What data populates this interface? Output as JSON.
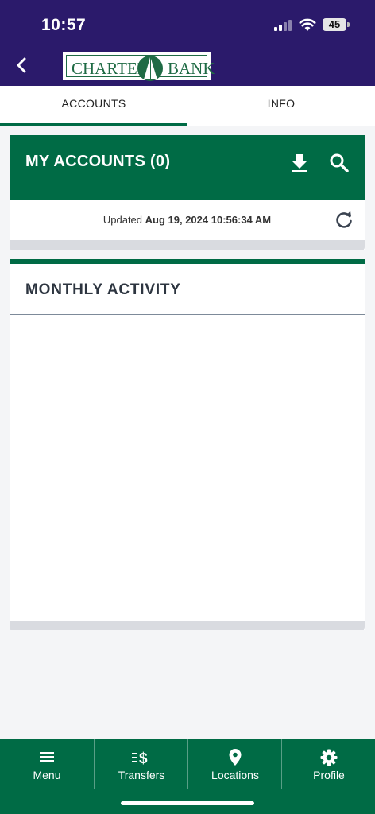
{
  "status_bar": {
    "time": "10:57",
    "battery": "45",
    "icons": [
      "signal-icon",
      "wifi-icon",
      "battery-icon"
    ]
  },
  "header": {
    "back_icon": "chevron-left-icon",
    "logo_left": "CHARTER",
    "logo_right": "BANK"
  },
  "tabs": [
    {
      "label": "ACCOUNTS",
      "active": true
    },
    {
      "label": "INFO",
      "active": false
    }
  ],
  "accounts": {
    "title": "MY ACCOUNTS (0)",
    "download_icon": "download-icon",
    "search_icon": "search-icon",
    "updated_prefix": "Updated",
    "updated_value": "Aug 19, 2024 10:56:34 AM",
    "refresh_icon": "refresh-icon"
  },
  "monthly": {
    "title": "MONTHLY ACTIVITY"
  },
  "bottom_nav": [
    {
      "label": "Menu",
      "icon": "menu-icon"
    },
    {
      "label": "Transfers",
      "icon": "transfer-icon"
    },
    {
      "label": "Locations",
      "icon": "location-pin-icon"
    },
    {
      "label": "Profile",
      "icon": "gear-icon"
    }
  ],
  "colors": {
    "header_purple": "#2b1a6b",
    "brand_green": "#006b45",
    "background": "#f4f5f7"
  }
}
